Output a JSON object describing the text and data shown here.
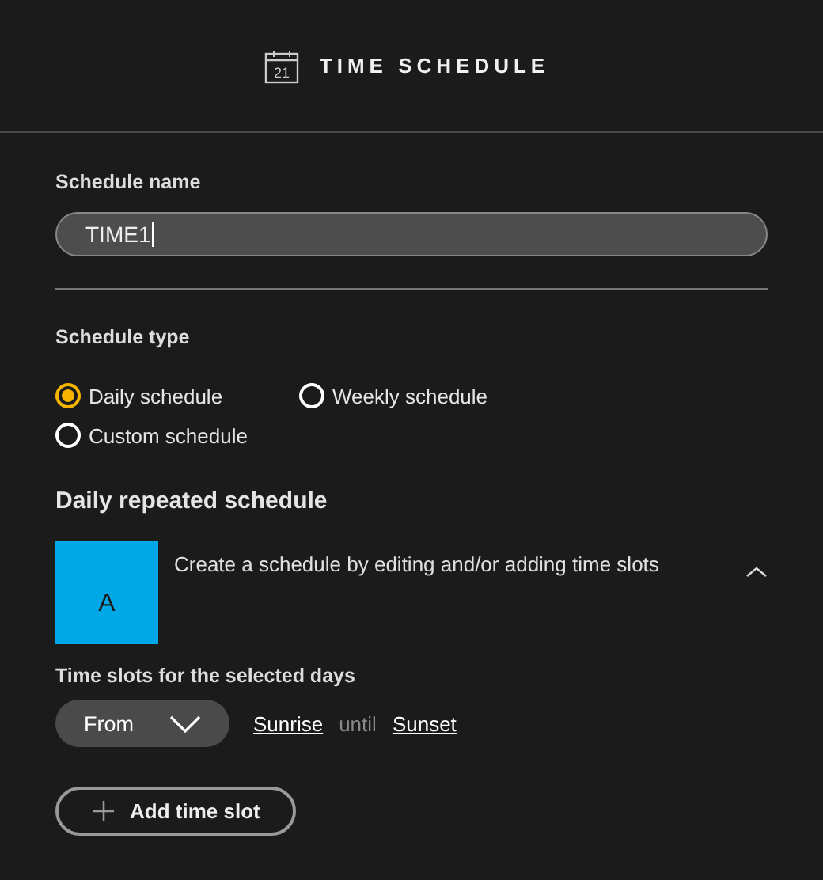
{
  "header": {
    "icon_text": "21",
    "title": "TIME SCHEDULE"
  },
  "schedule_name": {
    "label": "Schedule name",
    "value": "TIME1"
  },
  "schedule_type": {
    "label": "Schedule type",
    "options": [
      {
        "label": "Daily schedule",
        "selected": true
      },
      {
        "label": "Weekly schedule",
        "selected": false
      },
      {
        "label": "Custom schedule",
        "selected": false
      }
    ]
  },
  "section_title": "Daily repeated schedule",
  "slot_group": {
    "badge": "A",
    "color": "#00a8e8",
    "description": "Create a schedule by editing and/or adding time slots",
    "expanded": true
  },
  "time_slots": {
    "label": "Time slots for the selected days",
    "mode": "From",
    "start": "Sunrise",
    "connector": "until",
    "end": "Sunset"
  },
  "add_button": "Add time slot"
}
